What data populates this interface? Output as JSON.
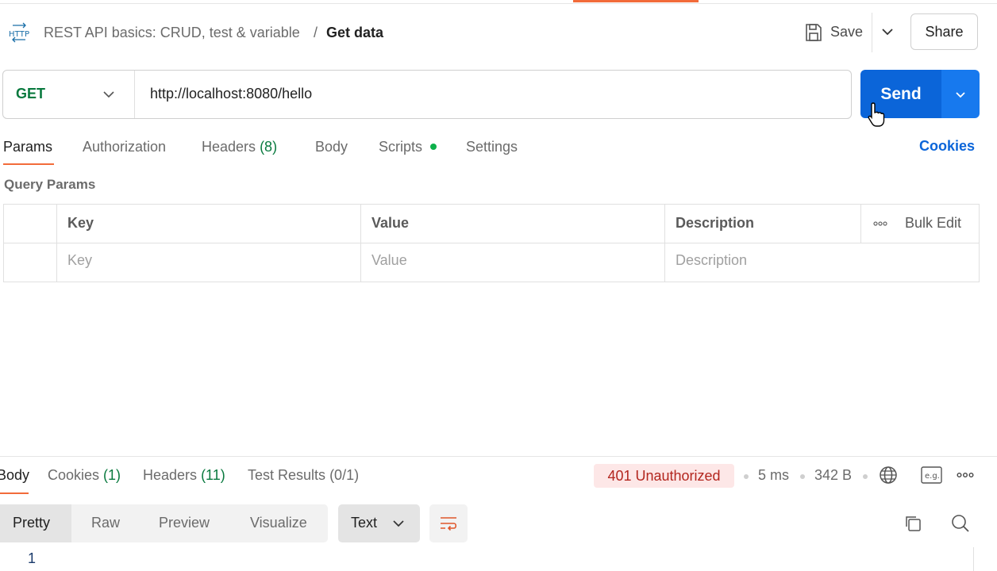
{
  "header": {
    "collection": "REST API basics: CRUD, test & variable",
    "separator": "/",
    "request_name": "Get data",
    "save_label": "Save",
    "share_label": "Share"
  },
  "request": {
    "method": "GET",
    "url": "http://localhost:8080/hello",
    "send_label": "Send"
  },
  "request_tabs": [
    {
      "label": "Params"
    },
    {
      "label": "Authorization"
    },
    {
      "label": "Headers",
      "count": "(8)"
    },
    {
      "label": "Body"
    },
    {
      "label": "Scripts"
    },
    {
      "label": "Settings"
    }
  ],
  "cookies_link": "Cookies",
  "query_params": {
    "title": "Query Params",
    "columns": [
      "Key",
      "Value",
      "Description"
    ],
    "bulk_edit": "Bulk Edit",
    "placeholders": [
      "Key",
      "Value",
      "Description"
    ]
  },
  "response": {
    "tabs": [
      {
        "label": "Body"
      },
      {
        "label": "Cookies",
        "count": "(1)"
      },
      {
        "label": "Headers",
        "count": "(11)"
      },
      {
        "label": "Test Results",
        "count": "(0/1)"
      }
    ],
    "status": "401 Unauthorized",
    "time": "5 ms",
    "size": "342 B",
    "views": [
      "Pretty",
      "Raw",
      "Preview",
      "Visualize"
    ],
    "format": "Text",
    "line_number": "1"
  },
  "colors": {
    "accent": "#f26b3a",
    "send": "#0b65d9",
    "method": "#0a7a3f",
    "error_bg": "#fde7e7",
    "error_text": "#b3261e"
  }
}
